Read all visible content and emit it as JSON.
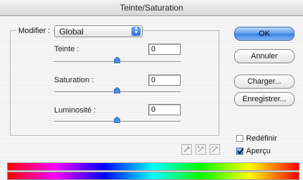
{
  "window": {
    "title": "Teinte/Saturation"
  },
  "modifier": {
    "label": "Modifier :",
    "value": "Global"
  },
  "sliders": {
    "hue": {
      "label": "Teinte :",
      "value": "0"
    },
    "saturation": {
      "label": "Saturation :",
      "value": "0"
    },
    "lightness": {
      "label": "Luminosité :",
      "value": "0"
    }
  },
  "buttons": {
    "ok": "OK",
    "cancel": "Annuler",
    "load": "Charger...",
    "save": "Enregistrer..."
  },
  "options": {
    "colorize": {
      "label": "Redéfinir",
      "checked": false
    },
    "preview": {
      "label": "Aperçu",
      "checked": true
    }
  },
  "icons": [
    "eyedropper-icon",
    "eyedropper-plus-icon",
    "eyedropper-minus-icon",
    "slider-thumb-icon",
    "checkmark-icon",
    "select-arrows-icon"
  ],
  "colors": {
    "ok_button": "#5b9bf0",
    "thumb": "#4a8be6"
  }
}
